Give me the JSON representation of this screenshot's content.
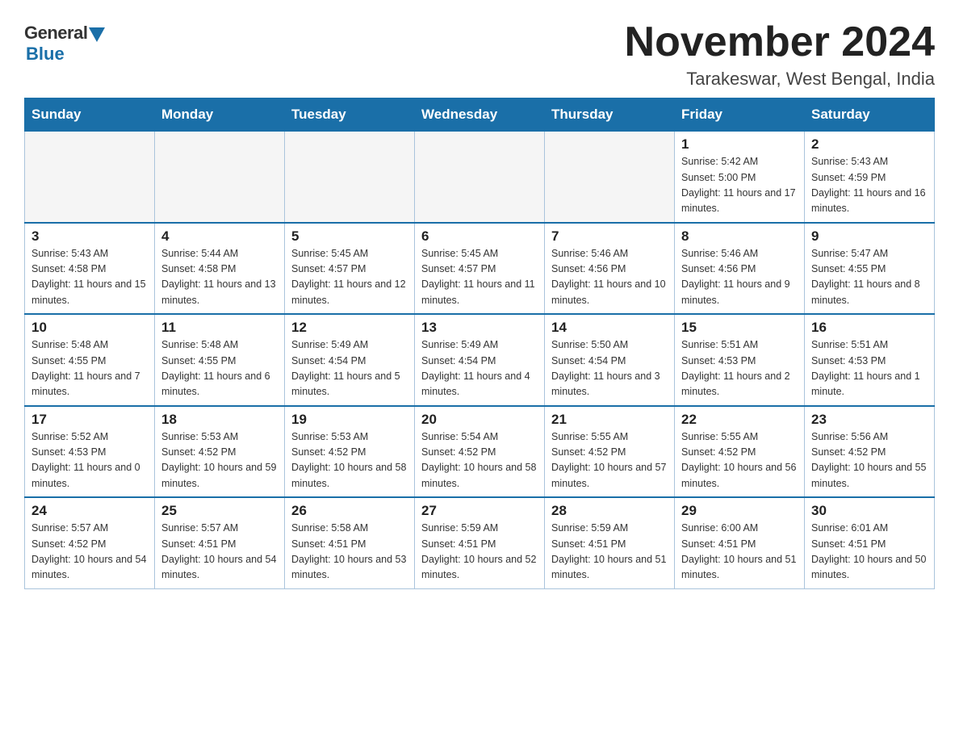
{
  "logo": {
    "general": "General",
    "blue": "Blue"
  },
  "title": "November 2024",
  "subtitle": "Tarakeswar, West Bengal, India",
  "days_of_week": [
    "Sunday",
    "Monday",
    "Tuesday",
    "Wednesday",
    "Thursday",
    "Friday",
    "Saturday"
  ],
  "weeks": [
    [
      {
        "day": "",
        "info": ""
      },
      {
        "day": "",
        "info": ""
      },
      {
        "day": "",
        "info": ""
      },
      {
        "day": "",
        "info": ""
      },
      {
        "day": "",
        "info": ""
      },
      {
        "day": "1",
        "info": "Sunrise: 5:42 AM\nSunset: 5:00 PM\nDaylight: 11 hours and 17 minutes."
      },
      {
        "day": "2",
        "info": "Sunrise: 5:43 AM\nSunset: 4:59 PM\nDaylight: 11 hours and 16 minutes."
      }
    ],
    [
      {
        "day": "3",
        "info": "Sunrise: 5:43 AM\nSunset: 4:58 PM\nDaylight: 11 hours and 15 minutes."
      },
      {
        "day": "4",
        "info": "Sunrise: 5:44 AM\nSunset: 4:58 PM\nDaylight: 11 hours and 13 minutes."
      },
      {
        "day": "5",
        "info": "Sunrise: 5:45 AM\nSunset: 4:57 PM\nDaylight: 11 hours and 12 minutes."
      },
      {
        "day": "6",
        "info": "Sunrise: 5:45 AM\nSunset: 4:57 PM\nDaylight: 11 hours and 11 minutes."
      },
      {
        "day": "7",
        "info": "Sunrise: 5:46 AM\nSunset: 4:56 PM\nDaylight: 11 hours and 10 minutes."
      },
      {
        "day": "8",
        "info": "Sunrise: 5:46 AM\nSunset: 4:56 PM\nDaylight: 11 hours and 9 minutes."
      },
      {
        "day": "9",
        "info": "Sunrise: 5:47 AM\nSunset: 4:55 PM\nDaylight: 11 hours and 8 minutes."
      }
    ],
    [
      {
        "day": "10",
        "info": "Sunrise: 5:48 AM\nSunset: 4:55 PM\nDaylight: 11 hours and 7 minutes."
      },
      {
        "day": "11",
        "info": "Sunrise: 5:48 AM\nSunset: 4:55 PM\nDaylight: 11 hours and 6 minutes."
      },
      {
        "day": "12",
        "info": "Sunrise: 5:49 AM\nSunset: 4:54 PM\nDaylight: 11 hours and 5 minutes."
      },
      {
        "day": "13",
        "info": "Sunrise: 5:49 AM\nSunset: 4:54 PM\nDaylight: 11 hours and 4 minutes."
      },
      {
        "day": "14",
        "info": "Sunrise: 5:50 AM\nSunset: 4:54 PM\nDaylight: 11 hours and 3 minutes."
      },
      {
        "day": "15",
        "info": "Sunrise: 5:51 AM\nSunset: 4:53 PM\nDaylight: 11 hours and 2 minutes."
      },
      {
        "day": "16",
        "info": "Sunrise: 5:51 AM\nSunset: 4:53 PM\nDaylight: 11 hours and 1 minute."
      }
    ],
    [
      {
        "day": "17",
        "info": "Sunrise: 5:52 AM\nSunset: 4:53 PM\nDaylight: 11 hours and 0 minutes."
      },
      {
        "day": "18",
        "info": "Sunrise: 5:53 AM\nSunset: 4:52 PM\nDaylight: 10 hours and 59 minutes."
      },
      {
        "day": "19",
        "info": "Sunrise: 5:53 AM\nSunset: 4:52 PM\nDaylight: 10 hours and 58 minutes."
      },
      {
        "day": "20",
        "info": "Sunrise: 5:54 AM\nSunset: 4:52 PM\nDaylight: 10 hours and 58 minutes."
      },
      {
        "day": "21",
        "info": "Sunrise: 5:55 AM\nSunset: 4:52 PM\nDaylight: 10 hours and 57 minutes."
      },
      {
        "day": "22",
        "info": "Sunrise: 5:55 AM\nSunset: 4:52 PM\nDaylight: 10 hours and 56 minutes."
      },
      {
        "day": "23",
        "info": "Sunrise: 5:56 AM\nSunset: 4:52 PM\nDaylight: 10 hours and 55 minutes."
      }
    ],
    [
      {
        "day": "24",
        "info": "Sunrise: 5:57 AM\nSunset: 4:52 PM\nDaylight: 10 hours and 54 minutes."
      },
      {
        "day": "25",
        "info": "Sunrise: 5:57 AM\nSunset: 4:51 PM\nDaylight: 10 hours and 54 minutes."
      },
      {
        "day": "26",
        "info": "Sunrise: 5:58 AM\nSunset: 4:51 PM\nDaylight: 10 hours and 53 minutes."
      },
      {
        "day": "27",
        "info": "Sunrise: 5:59 AM\nSunset: 4:51 PM\nDaylight: 10 hours and 52 minutes."
      },
      {
        "day": "28",
        "info": "Sunrise: 5:59 AM\nSunset: 4:51 PM\nDaylight: 10 hours and 51 minutes."
      },
      {
        "day": "29",
        "info": "Sunrise: 6:00 AM\nSunset: 4:51 PM\nDaylight: 10 hours and 51 minutes."
      },
      {
        "day": "30",
        "info": "Sunrise: 6:01 AM\nSunset: 4:51 PM\nDaylight: 10 hours and 50 minutes."
      }
    ]
  ]
}
